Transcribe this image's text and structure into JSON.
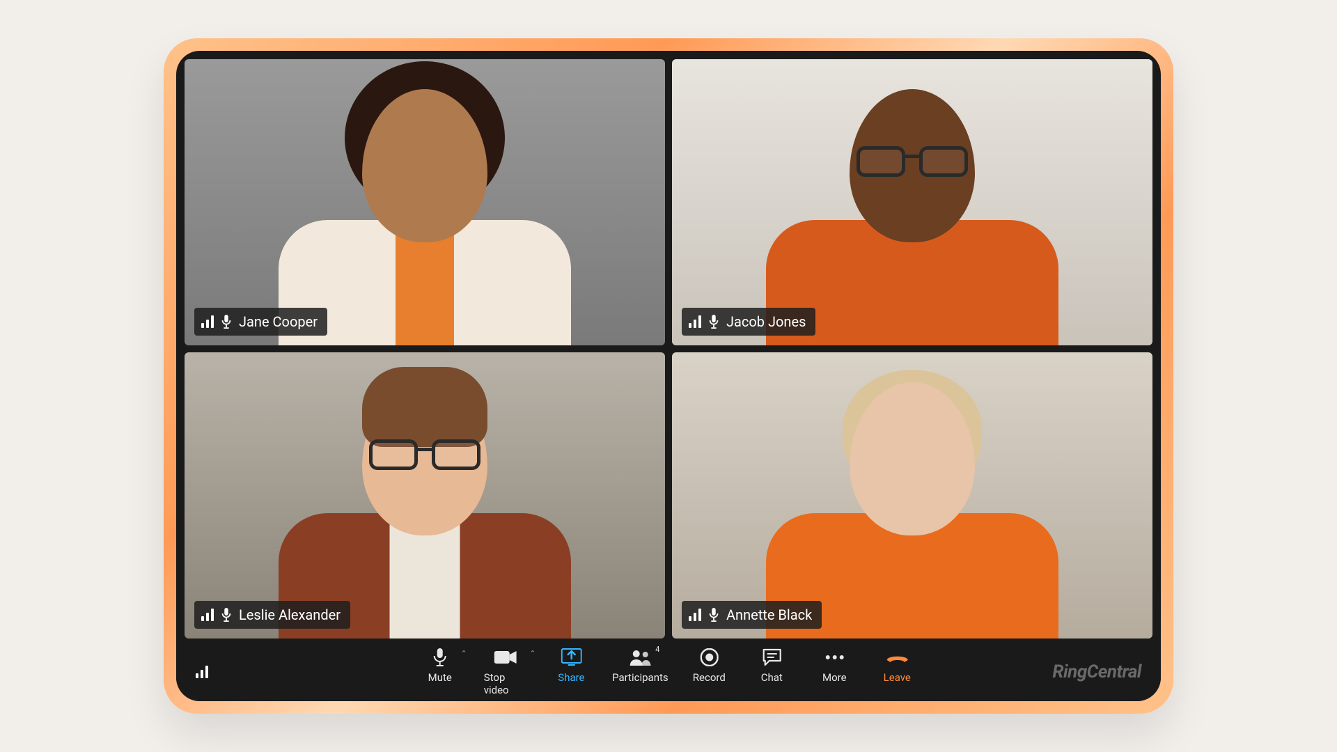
{
  "brand": "RingCentral",
  "participants": [
    {
      "name": "Jane Cooper"
    },
    {
      "name": "Jacob Jones"
    },
    {
      "name": "Leslie Alexander"
    },
    {
      "name": "Annette Black"
    }
  ],
  "toolbar": {
    "mute": "Mute",
    "stop_video": "Stop video",
    "share": "Share",
    "participants": "Participants",
    "participants_count": "4",
    "record": "Record",
    "chat": "Chat",
    "more": "More",
    "leave": "Leave"
  }
}
